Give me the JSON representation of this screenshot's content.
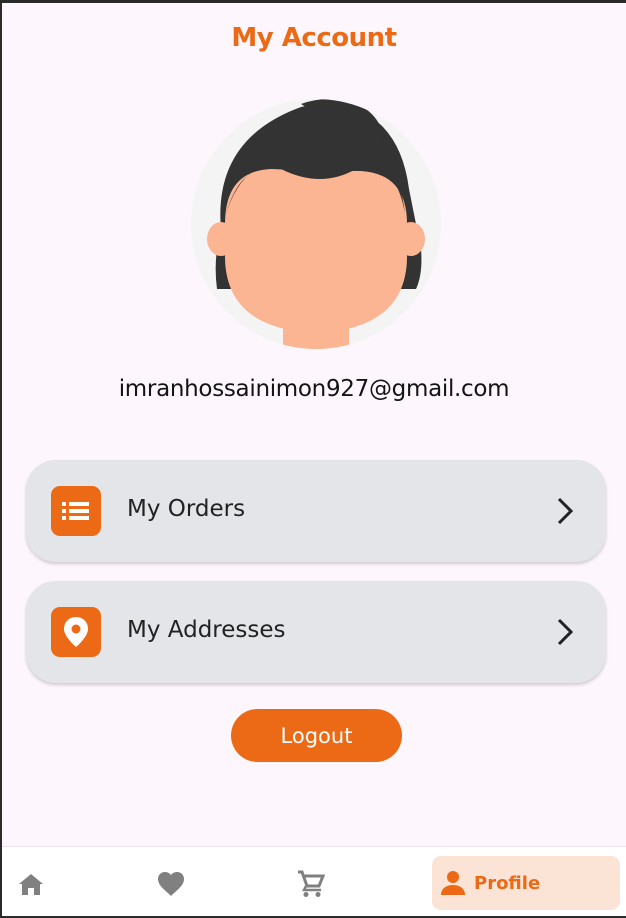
{
  "header": {
    "title": "My Account"
  },
  "profile": {
    "email": "imranhossainimon927@gmail.com",
    "avatar_icon": "person-avatar"
  },
  "menu": [
    {
      "label": "My Orders",
      "icon": "list-icon"
    },
    {
      "label": "My Addresses",
      "icon": "location-pin-icon"
    }
  ],
  "actions": {
    "logout_label": "Logout"
  },
  "bottom_nav": [
    {
      "icon": "home-icon",
      "label": "",
      "active": false
    },
    {
      "icon": "heart-icon",
      "label": "",
      "active": false
    },
    {
      "icon": "cart-icon",
      "label": "",
      "active": false
    },
    {
      "icon": "person-icon",
      "label": "Profile",
      "active": true
    }
  ],
  "colors": {
    "accent": "#ec6a16",
    "background": "#fdf6fc",
    "card": "#e4e5e8",
    "active_tab": "#fbe3d6"
  }
}
